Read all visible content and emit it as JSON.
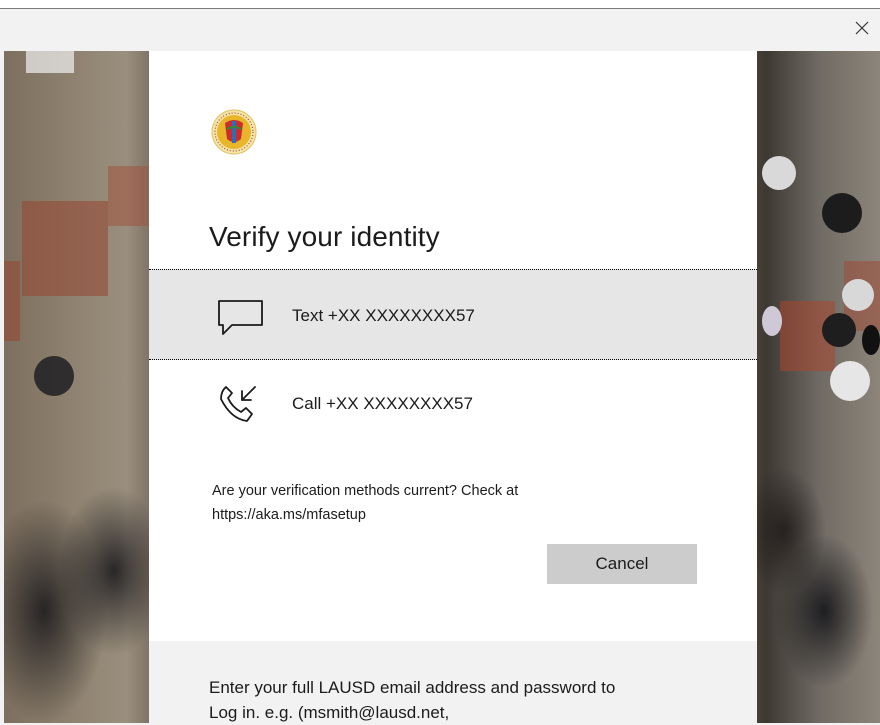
{
  "window": {
    "close_label": "×"
  },
  "dialog": {
    "title": "Verify your identity",
    "options": [
      {
        "label": "Text +XX XXXXXXXX57",
        "icon": "chat-bubble-icon"
      },
      {
        "label": "Call +XX XXXXXXXX57",
        "icon": "phone-incoming-icon"
      }
    ],
    "notice_line1": "Are your verification methods current? Check at",
    "notice_line2": "https://aka.ms/mfasetup",
    "cancel_label": "Cancel"
  },
  "footer": {
    "line1": "Enter your full LAUSD email address and password to",
    "line2": "Log in. e.g. (msmith@lausd.net,"
  },
  "colors": {
    "card_background": "#ffffff",
    "selected_option": "#e6e6e6",
    "cancel_button": "#cccccc",
    "footer_background": "#f2f2f2",
    "text": "#1b1b1b"
  }
}
